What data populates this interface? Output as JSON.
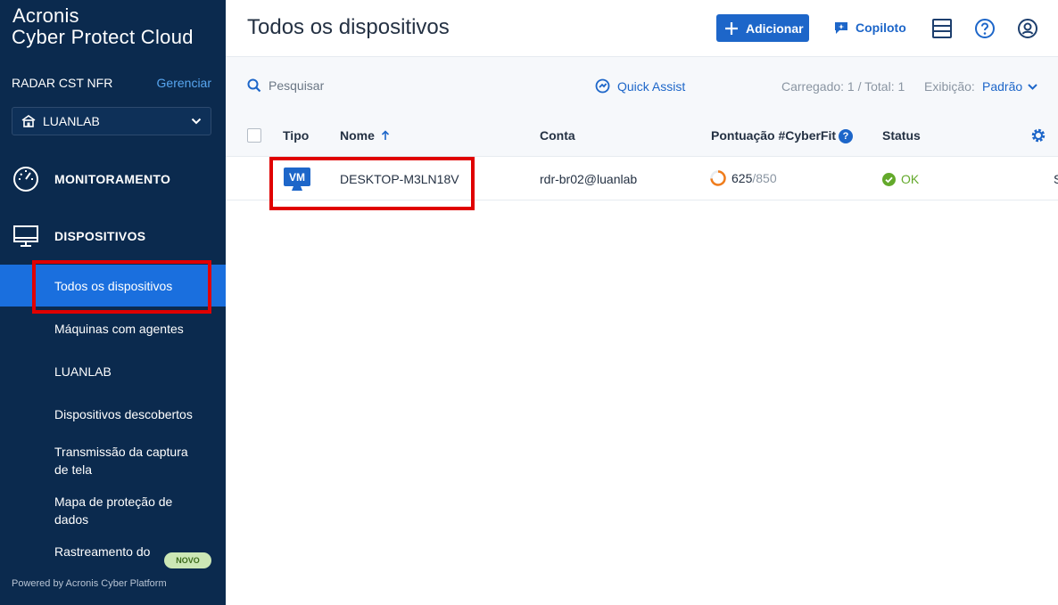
{
  "brand": {
    "line1": "Acronis",
    "line2": "Cyber Protect Cloud",
    "powered_by": "Powered by Acronis Cyber Platform"
  },
  "tenant": {
    "name": "RADAR CST NFR",
    "manage_label": "Gerenciar",
    "selected": "LUANLAB"
  },
  "sidebar": {
    "sections": [
      {
        "label": "MONITORAMENTO",
        "icon": "gauge-icon"
      },
      {
        "label": "DISPOSITIVOS",
        "icon": "monitor-icon"
      }
    ],
    "items": [
      {
        "label": "Todos os dispositivos",
        "active": true
      },
      {
        "label": "Máquinas com agentes"
      },
      {
        "label": "LUANLAB"
      },
      {
        "label": "Dispositivos descobertos"
      },
      {
        "label": "Transmissão da captura de tela"
      },
      {
        "label": "Mapa de proteção de dados"
      },
      {
        "label": "Rastreamento do",
        "badge": "NOVO"
      }
    ]
  },
  "header": {
    "title": "Todos os dispositivos",
    "add_label": "Adicionar",
    "copilot_label": "Copiloto",
    "icons": [
      "layout-icon",
      "help-icon",
      "user-icon"
    ]
  },
  "toolbar": {
    "search_placeholder": "Pesquisar",
    "quick_assist": "Quick Assist",
    "loaded_text": "Carregado: 1 / Total: 1",
    "view_label": "Exibição:",
    "view_value": "Padrão"
  },
  "table": {
    "columns": {
      "type": "Tipo",
      "name": "Nome",
      "account": "Conta",
      "score": "Pontuação #CyberFit",
      "status": "Status"
    },
    "rows": [
      {
        "type_badge": "VM",
        "name": "DESKTOP-M3LN18V",
        "account": "rdr-br02@luanlab",
        "score": "625",
        "score_max": "/850",
        "score_fraction": 0.735,
        "status": "OK",
        "truncated": "S"
      }
    ]
  },
  "colors": {
    "sidebar_bg": "#0b2a4e",
    "accent": "#1d66c9",
    "active_item": "#1a6fde",
    "ok": "#63a92b",
    "score_ring": "#f07c1b",
    "highlight": "#e00000"
  }
}
